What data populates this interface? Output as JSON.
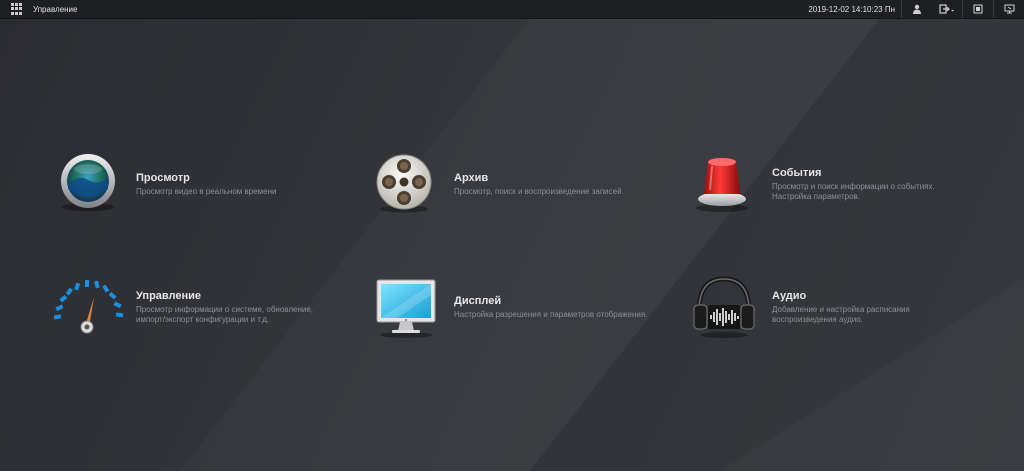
{
  "topbar": {
    "title": "Управление",
    "datetime": "2019-12-02 14:10:23 Пн",
    "icons": [
      "apps-grid-icon",
      "user-icon",
      "logout-icon",
      "record-icon",
      "display-icon"
    ]
  },
  "tiles": [
    {
      "title": "Просмотр",
      "desc": "Просмотр видео в реальном времени",
      "icon": "live-view-icon"
    },
    {
      "title": "Архив",
      "desc": "Просмотр, поиск и воспроизведение записей.",
      "icon": "film-reel-icon"
    },
    {
      "title": "События",
      "desc": "Просмотр и поиск информации о событиях. Настройка параметров.",
      "icon": "alarm-siren-icon"
    },
    {
      "title": "Управление",
      "desc": "Просмотр информации о системе, обновление, импорт/экспорт конфигурации и т.д.",
      "icon": "gauge-icon"
    },
    {
      "title": "Дисплей",
      "desc": "Настройка разрешения и параметров отображения.",
      "icon": "monitor-icon"
    },
    {
      "title": "Аудио",
      "desc": "Добавление и настройка расписания воспроизведения аудио.",
      "icon": "headphones-icon"
    }
  ],
  "colors": {
    "background": "#2e2f34",
    "topbar": "#1e1f22",
    "accent": "#1a8fe0"
  }
}
